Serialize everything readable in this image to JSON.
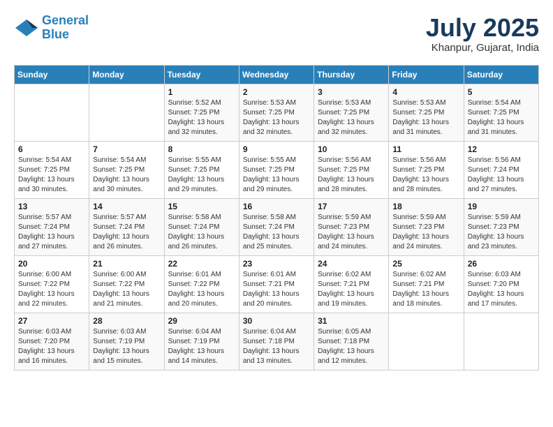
{
  "header": {
    "logo_line1": "General",
    "logo_line2": "Blue",
    "month_year": "July 2025",
    "location": "Khanpur, Gujarat, India"
  },
  "days_of_week": [
    "Sunday",
    "Monday",
    "Tuesday",
    "Wednesday",
    "Thursday",
    "Friday",
    "Saturday"
  ],
  "weeks": [
    [
      {
        "day": "",
        "info": ""
      },
      {
        "day": "",
        "info": ""
      },
      {
        "day": "1",
        "info": "Sunrise: 5:52 AM\nSunset: 7:25 PM\nDaylight: 13 hours\nand 32 minutes."
      },
      {
        "day": "2",
        "info": "Sunrise: 5:53 AM\nSunset: 7:25 PM\nDaylight: 13 hours\nand 32 minutes."
      },
      {
        "day": "3",
        "info": "Sunrise: 5:53 AM\nSunset: 7:25 PM\nDaylight: 13 hours\nand 32 minutes."
      },
      {
        "day": "4",
        "info": "Sunrise: 5:53 AM\nSunset: 7:25 PM\nDaylight: 13 hours\nand 31 minutes."
      },
      {
        "day": "5",
        "info": "Sunrise: 5:54 AM\nSunset: 7:25 PM\nDaylight: 13 hours\nand 31 minutes."
      }
    ],
    [
      {
        "day": "6",
        "info": "Sunrise: 5:54 AM\nSunset: 7:25 PM\nDaylight: 13 hours\nand 30 minutes."
      },
      {
        "day": "7",
        "info": "Sunrise: 5:54 AM\nSunset: 7:25 PM\nDaylight: 13 hours\nand 30 minutes."
      },
      {
        "day": "8",
        "info": "Sunrise: 5:55 AM\nSunset: 7:25 PM\nDaylight: 13 hours\nand 29 minutes."
      },
      {
        "day": "9",
        "info": "Sunrise: 5:55 AM\nSunset: 7:25 PM\nDaylight: 13 hours\nand 29 minutes."
      },
      {
        "day": "10",
        "info": "Sunrise: 5:56 AM\nSunset: 7:25 PM\nDaylight: 13 hours\nand 28 minutes."
      },
      {
        "day": "11",
        "info": "Sunrise: 5:56 AM\nSunset: 7:25 PM\nDaylight: 13 hours\nand 28 minutes."
      },
      {
        "day": "12",
        "info": "Sunrise: 5:56 AM\nSunset: 7:24 PM\nDaylight: 13 hours\nand 27 minutes."
      }
    ],
    [
      {
        "day": "13",
        "info": "Sunrise: 5:57 AM\nSunset: 7:24 PM\nDaylight: 13 hours\nand 27 minutes."
      },
      {
        "day": "14",
        "info": "Sunrise: 5:57 AM\nSunset: 7:24 PM\nDaylight: 13 hours\nand 26 minutes."
      },
      {
        "day": "15",
        "info": "Sunrise: 5:58 AM\nSunset: 7:24 PM\nDaylight: 13 hours\nand 26 minutes."
      },
      {
        "day": "16",
        "info": "Sunrise: 5:58 AM\nSunset: 7:24 PM\nDaylight: 13 hours\nand 25 minutes."
      },
      {
        "day": "17",
        "info": "Sunrise: 5:59 AM\nSunset: 7:23 PM\nDaylight: 13 hours\nand 24 minutes."
      },
      {
        "day": "18",
        "info": "Sunrise: 5:59 AM\nSunset: 7:23 PM\nDaylight: 13 hours\nand 24 minutes."
      },
      {
        "day": "19",
        "info": "Sunrise: 5:59 AM\nSunset: 7:23 PM\nDaylight: 13 hours\nand 23 minutes."
      }
    ],
    [
      {
        "day": "20",
        "info": "Sunrise: 6:00 AM\nSunset: 7:22 PM\nDaylight: 13 hours\nand 22 minutes."
      },
      {
        "day": "21",
        "info": "Sunrise: 6:00 AM\nSunset: 7:22 PM\nDaylight: 13 hours\nand 21 minutes."
      },
      {
        "day": "22",
        "info": "Sunrise: 6:01 AM\nSunset: 7:22 PM\nDaylight: 13 hours\nand 20 minutes."
      },
      {
        "day": "23",
        "info": "Sunrise: 6:01 AM\nSunset: 7:21 PM\nDaylight: 13 hours\nand 20 minutes."
      },
      {
        "day": "24",
        "info": "Sunrise: 6:02 AM\nSunset: 7:21 PM\nDaylight: 13 hours\nand 19 minutes."
      },
      {
        "day": "25",
        "info": "Sunrise: 6:02 AM\nSunset: 7:21 PM\nDaylight: 13 hours\nand 18 minutes."
      },
      {
        "day": "26",
        "info": "Sunrise: 6:03 AM\nSunset: 7:20 PM\nDaylight: 13 hours\nand 17 minutes."
      }
    ],
    [
      {
        "day": "27",
        "info": "Sunrise: 6:03 AM\nSunset: 7:20 PM\nDaylight: 13 hours\nand 16 minutes."
      },
      {
        "day": "28",
        "info": "Sunrise: 6:03 AM\nSunset: 7:19 PM\nDaylight: 13 hours\nand 15 minutes."
      },
      {
        "day": "29",
        "info": "Sunrise: 6:04 AM\nSunset: 7:19 PM\nDaylight: 13 hours\nand 14 minutes."
      },
      {
        "day": "30",
        "info": "Sunrise: 6:04 AM\nSunset: 7:18 PM\nDaylight: 13 hours\nand 13 minutes."
      },
      {
        "day": "31",
        "info": "Sunrise: 6:05 AM\nSunset: 7:18 PM\nDaylight: 13 hours\nand 12 minutes."
      },
      {
        "day": "",
        "info": ""
      },
      {
        "day": "",
        "info": ""
      }
    ]
  ]
}
